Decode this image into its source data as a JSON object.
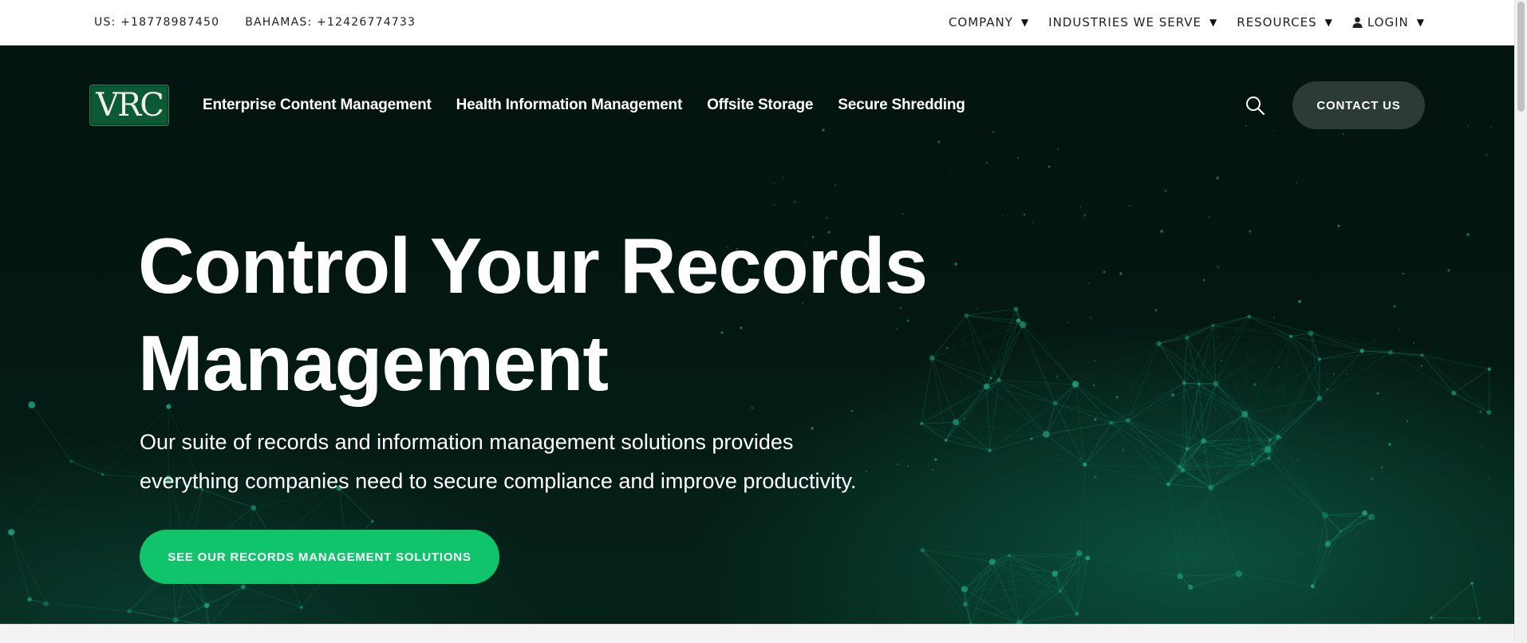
{
  "topbar": {
    "phone_us": "US: +18778987450",
    "phone_bahamas": "BAHAMAS: +12426774733",
    "util_nav": [
      {
        "label": "COMPANY",
        "icon": "caret-down-icon"
      },
      {
        "label": "INDUSTRIES WE SERVE",
        "icon": "caret-down-icon"
      },
      {
        "label": "RESOURCES",
        "icon": "caret-down-icon"
      },
      {
        "label": "LOGIN",
        "icon": "user-icon"
      }
    ],
    "caret": "▼"
  },
  "header": {
    "logo_text": "VRC",
    "nav": [
      "Enterprise Content Management",
      "Health Information Management",
      "Offsite Storage",
      "Secure Shredding"
    ],
    "search_icon": "search-icon",
    "contact_label": "CONTACT US"
  },
  "hero": {
    "headline_line1": "Control Your Records",
    "headline_line2": "Management",
    "subhead_line1": "Our suite of records and information management solutions provides",
    "subhead_line2": "everything companies need to secure compliance and improve productivity.",
    "cta_label": "SEE OUR RECORDS MANAGEMENT SOLUTIONS"
  },
  "cookie_banner": {
    "text": ""
  },
  "colors": {
    "hero_bg": "#04140f",
    "cta_green": "#10c46c",
    "contact_bg": "#2c3b37",
    "logo_green": "#0c5a35",
    "network_teal": "#1fa07a"
  }
}
